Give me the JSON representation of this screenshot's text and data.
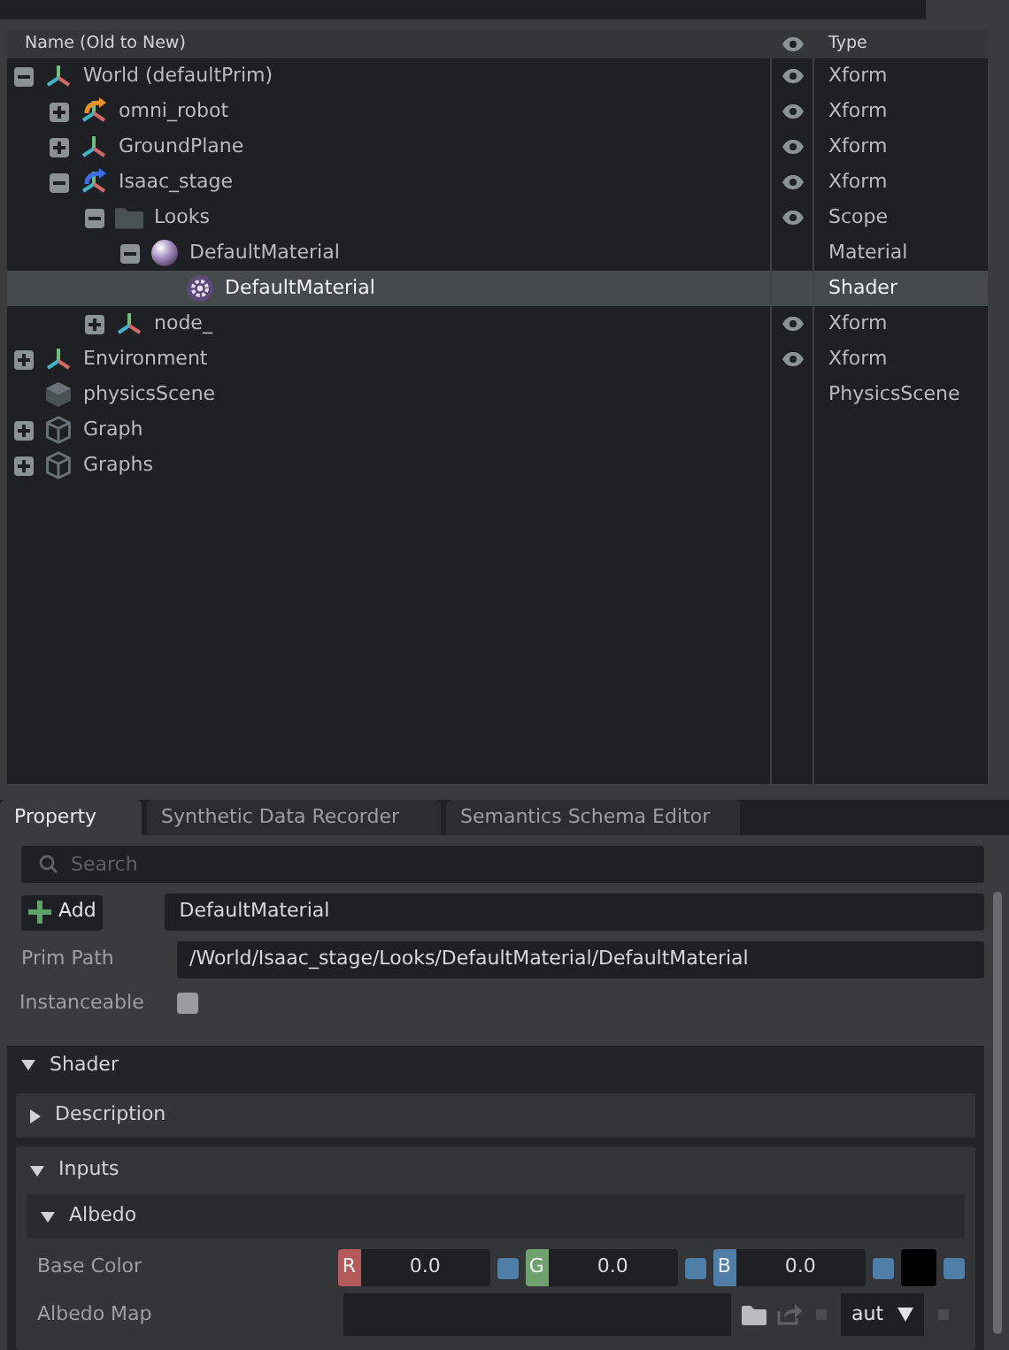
{
  "stage": {
    "columns": {
      "name": "Name (Old to New)",
      "type": "Type"
    },
    "tree": [
      {
        "label": "World (defaultPrim)",
        "kind": "xform",
        "expanded": true,
        "visible": true,
        "type": "Xform",
        "selected": false,
        "children": [
          {
            "label": "omni_robot",
            "kind": "robot",
            "expanded": false,
            "visible": true,
            "type": "Xform",
            "selected": false
          },
          {
            "label": "GroundPlane",
            "kind": "xform",
            "expanded": false,
            "visible": true,
            "type": "Xform",
            "selected": false
          },
          {
            "label": "Isaac_stage",
            "kind": "stage",
            "expanded": true,
            "visible": true,
            "type": "Xform",
            "selected": false,
            "children": [
              {
                "label": "Looks",
                "kind": "folder",
                "expanded": true,
                "visible": true,
                "type": "Scope",
                "selected": false,
                "children": [
                  {
                    "label": "DefaultMaterial",
                    "kind": "material",
                    "expanded": true,
                    "visible": false,
                    "type": "Material",
                    "selected": false,
                    "children": [
                      {
                        "label": "DefaultMaterial",
                        "kind": "shader",
                        "visible": false,
                        "type": "Shader",
                        "selected": true
                      }
                    ]
                  }
                ]
              },
              {
                "label": "node_",
                "kind": "xform",
                "expanded": false,
                "visible": true,
                "type": "Xform",
                "selected": false
              }
            ]
          }
        ]
      },
      {
        "label": "Environment",
        "kind": "xform",
        "expanded": false,
        "visible": true,
        "type": "Xform",
        "selected": false
      },
      {
        "label": "physicsScene",
        "kind": "scene",
        "visible": false,
        "type": "PhysicsScene",
        "selected": false
      },
      {
        "label": "Graph",
        "kind": "graph",
        "expanded": false,
        "visible": false,
        "selected": false
      },
      {
        "label": "Graphs",
        "kind": "graph",
        "expanded": false,
        "visible": false,
        "selected": false
      }
    ]
  },
  "tabs": [
    {
      "label": "Property",
      "selected": true
    },
    {
      "label": "Synthetic Data Recorder",
      "selected": false
    },
    {
      "label": "Semantics Schema Editor",
      "selected": false
    }
  ],
  "property": {
    "search": {
      "placeholder": "Search"
    },
    "add_button": "Add",
    "name_value": "DefaultMaterial",
    "prim_path_label": "Prim Path",
    "prim_path": "/World/Isaac_stage/Looks/DefaultMaterial/DefaultMaterial",
    "instanceable_label": "Instanceable",
    "instanceable": false,
    "shader": {
      "title": "Shader",
      "description": "Description",
      "inputs": "Inputs",
      "albedo": "Albedo",
      "base_color": {
        "label": "Base Color",
        "channels": [
          {
            "name": "R",
            "value": "0.0",
            "color": "#b55a5a"
          },
          {
            "name": "G",
            "value": "0.0",
            "color": "#6fa26f"
          },
          {
            "name": "B",
            "value": "0.0",
            "color": "#4f7fa8"
          }
        ],
        "color": "#000000"
      },
      "albedo_map": {
        "label": "Albedo Map",
        "mode": "aut"
      }
    }
  }
}
